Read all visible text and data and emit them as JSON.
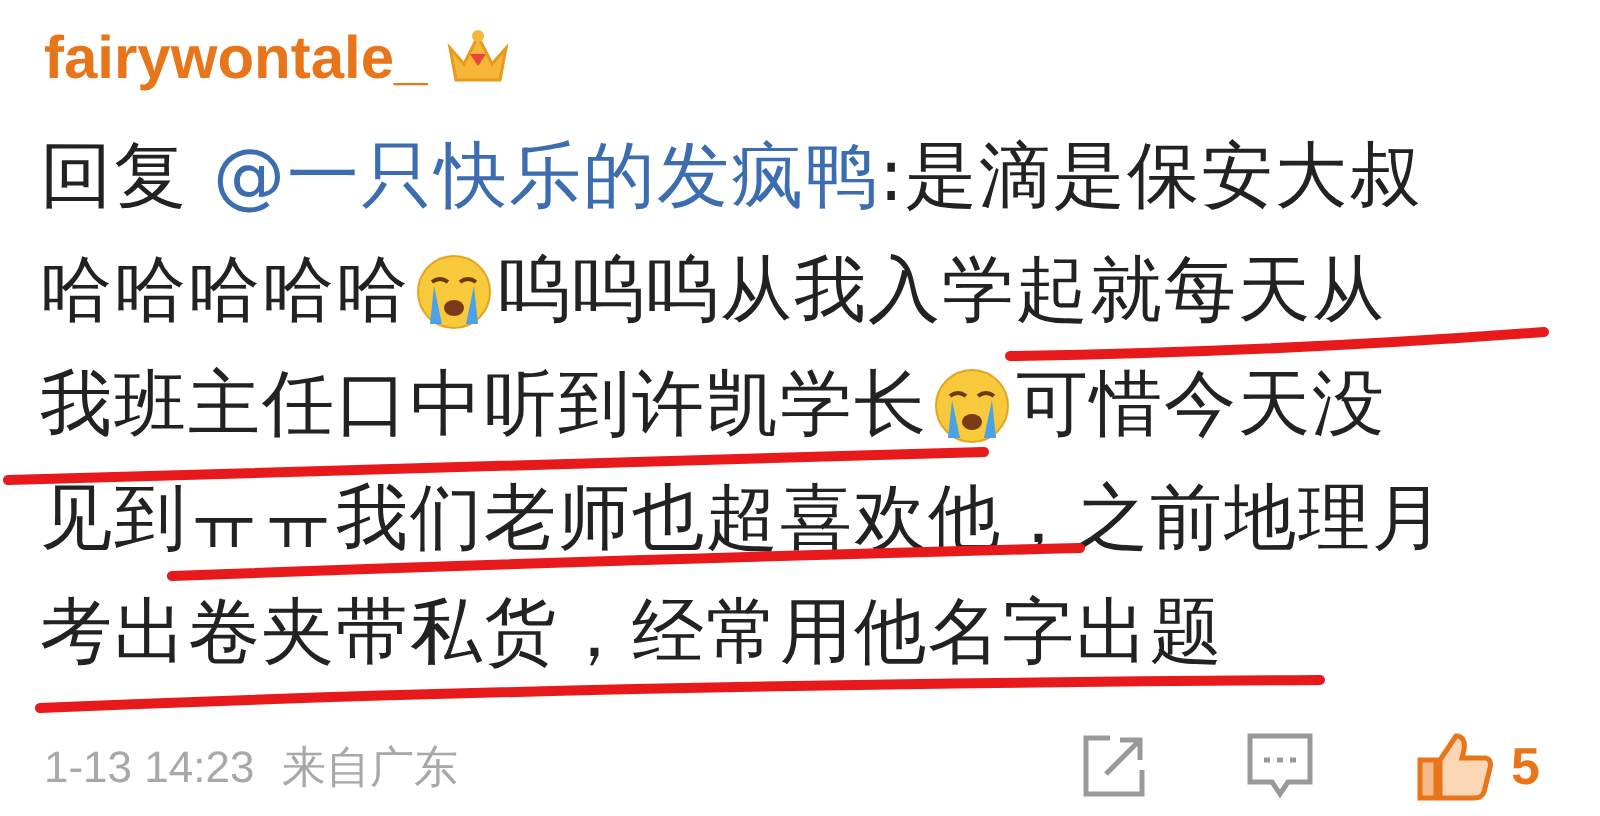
{
  "comment": {
    "username": "fairywontale_",
    "lines": [
      [
        {
          "kind": "text",
          "text": "回复 "
        },
        {
          "kind": "mention",
          "text": "@一只快乐的发疯鸭"
        },
        {
          "kind": "text",
          "text": ":是滴是保安大叔"
        }
      ],
      [
        {
          "kind": "text",
          "text": "哈哈哈哈哈"
        },
        {
          "kind": "emoji"
        },
        {
          "kind": "text",
          "text": "呜呜呜从我入学起就每天从"
        }
      ],
      [
        {
          "kind": "text",
          "text": "我班主任口中听到许凯学长"
        },
        {
          "kind": "emoji"
        },
        {
          "kind": "text",
          "text": "可惜今天没"
        }
      ],
      [
        {
          "kind": "text",
          "text": "见到ㅠㅠ我们老师也超喜欢他，之前地理月"
        }
      ],
      [
        {
          "kind": "text",
          "text": "考出卷夹带私货，经常用他名字出题"
        }
      ]
    ],
    "time": "1-13 14:23",
    "source": "来自广东",
    "likes": "5"
  }
}
